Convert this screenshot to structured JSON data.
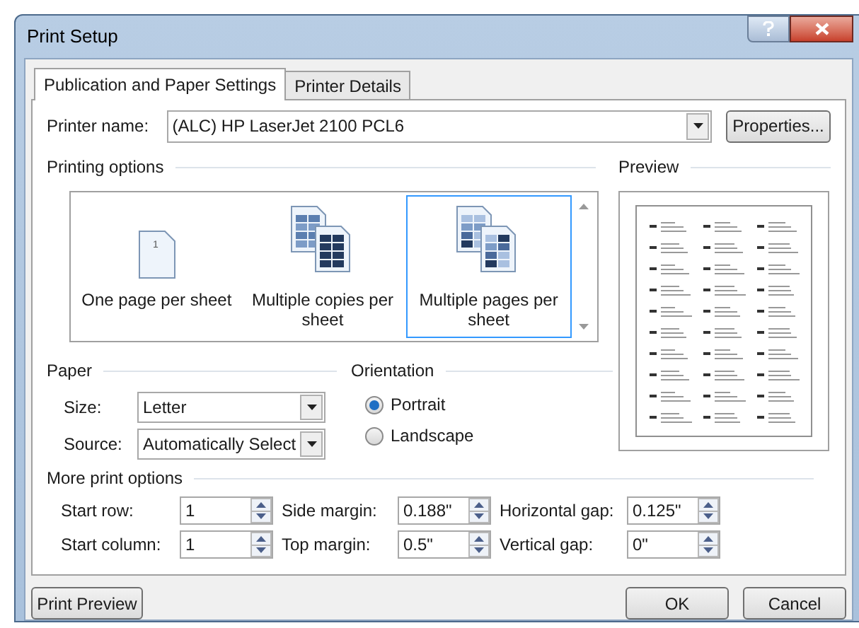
{
  "window": {
    "title": "Print Setup"
  },
  "tabs": [
    {
      "label": "Publication and Paper Settings",
      "selected": true
    },
    {
      "label": "Printer Details",
      "selected": false
    }
  ],
  "printer": {
    "label": "Printer name:",
    "value": "(ALC) HP LaserJet 2100 PCL6",
    "button": "Properties..."
  },
  "printing_options": {
    "title": "Printing options",
    "items": [
      {
        "label": "One page per sheet",
        "kind": "single",
        "icon_text": "1",
        "selected": false
      },
      {
        "label": "Multiple copies per sheet",
        "kind": "copies",
        "selected": false
      },
      {
        "label": "Multiple pages per sheet",
        "kind": "pages",
        "selected": true
      }
    ]
  },
  "preview": {
    "title": "Preview"
  },
  "paper": {
    "title": "Paper",
    "fields": [
      {
        "label": "Size:",
        "value": "Letter"
      },
      {
        "label": "Source:",
        "value": "Automatically Select"
      }
    ]
  },
  "orientation": {
    "title": "Orientation",
    "options": [
      {
        "label": "Portrait",
        "selected": true
      },
      {
        "label": "Landscape",
        "selected": false
      }
    ]
  },
  "more": {
    "title": "More print options",
    "fields": [
      {
        "label": "Start row:",
        "value": "1"
      },
      {
        "label": "Side margin:",
        "value": "0.188\""
      },
      {
        "label": "Horizontal gap:",
        "value": "0.125\""
      },
      {
        "label": "Start column:",
        "value": "1"
      },
      {
        "label": "Top margin:",
        "value": "0.5\""
      },
      {
        "label": "Vertical gap:",
        "value": "0\""
      }
    ]
  },
  "buttons": {
    "preview": "Print Preview",
    "ok": "OK",
    "cancel": "Cancel"
  }
}
